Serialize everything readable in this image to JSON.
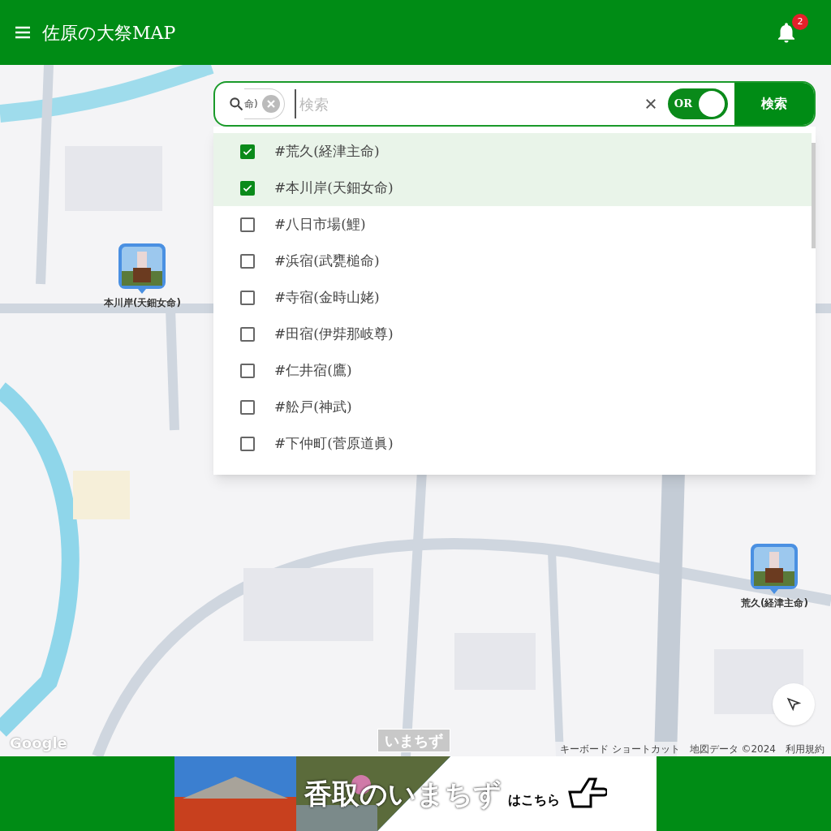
{
  "header": {
    "title": "佐原の大祭MAP",
    "notification_count": "2"
  },
  "search": {
    "chip": "命)",
    "placeholder": "検索",
    "toggle": {
      "label": "OR",
      "on": true
    },
    "button": "検索"
  },
  "tags": [
    {
      "label": "#荒久(経津主命)",
      "checked": true
    },
    {
      "label": "#本川岸(天鈿女命)",
      "checked": true
    },
    {
      "label": "#八日市場(鯉)",
      "checked": false
    },
    {
      "label": "#浜宿(武甕槌命)",
      "checked": false
    },
    {
      "label": "#寺宿(金時山姥)",
      "checked": false
    },
    {
      "label": "#田宿(伊弉那岐尊)",
      "checked": false
    },
    {
      "label": "#仁井宿(鷹)",
      "checked": false
    },
    {
      "label": "#舩戸(神武)",
      "checked": false
    },
    {
      "label": "#下仲町(菅原道眞)",
      "checked": false
    }
  ],
  "markers": [
    {
      "label": "本川岸(天鈿女命)"
    },
    {
      "label": "荒久(経津主命)"
    }
  ],
  "map": {
    "logo": "いまちず",
    "google": "Google",
    "attribution": [
      "キーボード ショートカット",
      "地図データ ©2024",
      "利用規約"
    ]
  },
  "banner": {
    "title": "香取のいまちず",
    "suffix": "はこちら"
  }
}
